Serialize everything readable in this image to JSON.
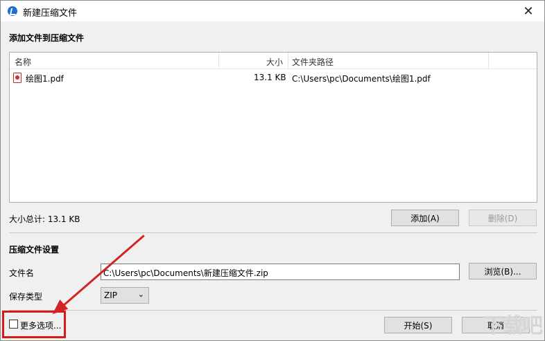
{
  "window": {
    "title": "新建压缩文件",
    "close_glyph": "✕"
  },
  "add_section": {
    "title": "添加文件到压缩文件"
  },
  "filelist": {
    "columns": [
      "名称",
      "大小",
      "文件夹路径"
    ],
    "rows": [
      {
        "name": "绘图1.pdf",
        "size": "13.1 KB",
        "path": "C:\\Users\\pc\\Documents\\绘图1.pdf",
        "icon": "pdf-file-icon"
      }
    ]
  },
  "summary": "大小总计: 13.1 KB",
  "buttons": {
    "add": "添加(A)",
    "delete": "删除(D)",
    "browse": "浏览(B)...",
    "start": "开始(S)",
    "cancel": "取消"
  },
  "settings": {
    "title": "压缩文件设置",
    "filename_label": "文件名",
    "filename_value": "C:\\Users\\pc\\Documents\\新建压缩文件.zip",
    "type_label": "保存类型",
    "type_value": "ZIP",
    "more_options": "更多选项..."
  },
  "watermark": "下载吧",
  "colors": {
    "accent": "#1e6fd0",
    "annotation": "#d81919"
  }
}
